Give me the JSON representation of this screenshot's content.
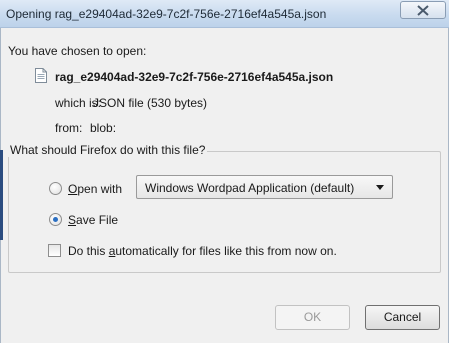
{
  "window": {
    "title": "Opening rag_e29404ad-32e9-7c2f-756e-2716ef4a545a.json",
    "close_icon": "close-icon"
  },
  "dialog": {
    "intro": "You have chosen to open:",
    "file_icon": "document-icon",
    "file_name": "rag_e29404ad-32e9-7c2f-756e-2716ef4a545a.json",
    "which_label": "which is:",
    "which_value": "JSON file (530 bytes)",
    "from_label": "from:",
    "from_value": "blob:"
  },
  "action_group": {
    "legend": "What should Firefox do with this file?",
    "open_with": {
      "mnemonic": "O",
      "rest": "pen with",
      "selected": false
    },
    "application_select": {
      "value": "Windows Wordpad Application (default)"
    },
    "save_file": {
      "mnemonic": "S",
      "rest": "ave File",
      "selected": true
    },
    "auto_checkbox": {
      "before": "Do this ",
      "mnemonic": "a",
      "after": "utomatically for files like this from now on.",
      "checked": false
    }
  },
  "buttons": {
    "ok": "OK",
    "cancel": "Cancel"
  },
  "colors": {
    "titlebar": "#c9dbef",
    "dialog_bg": "#f0f0f0",
    "radio_dot": "#2b6fc2"
  }
}
